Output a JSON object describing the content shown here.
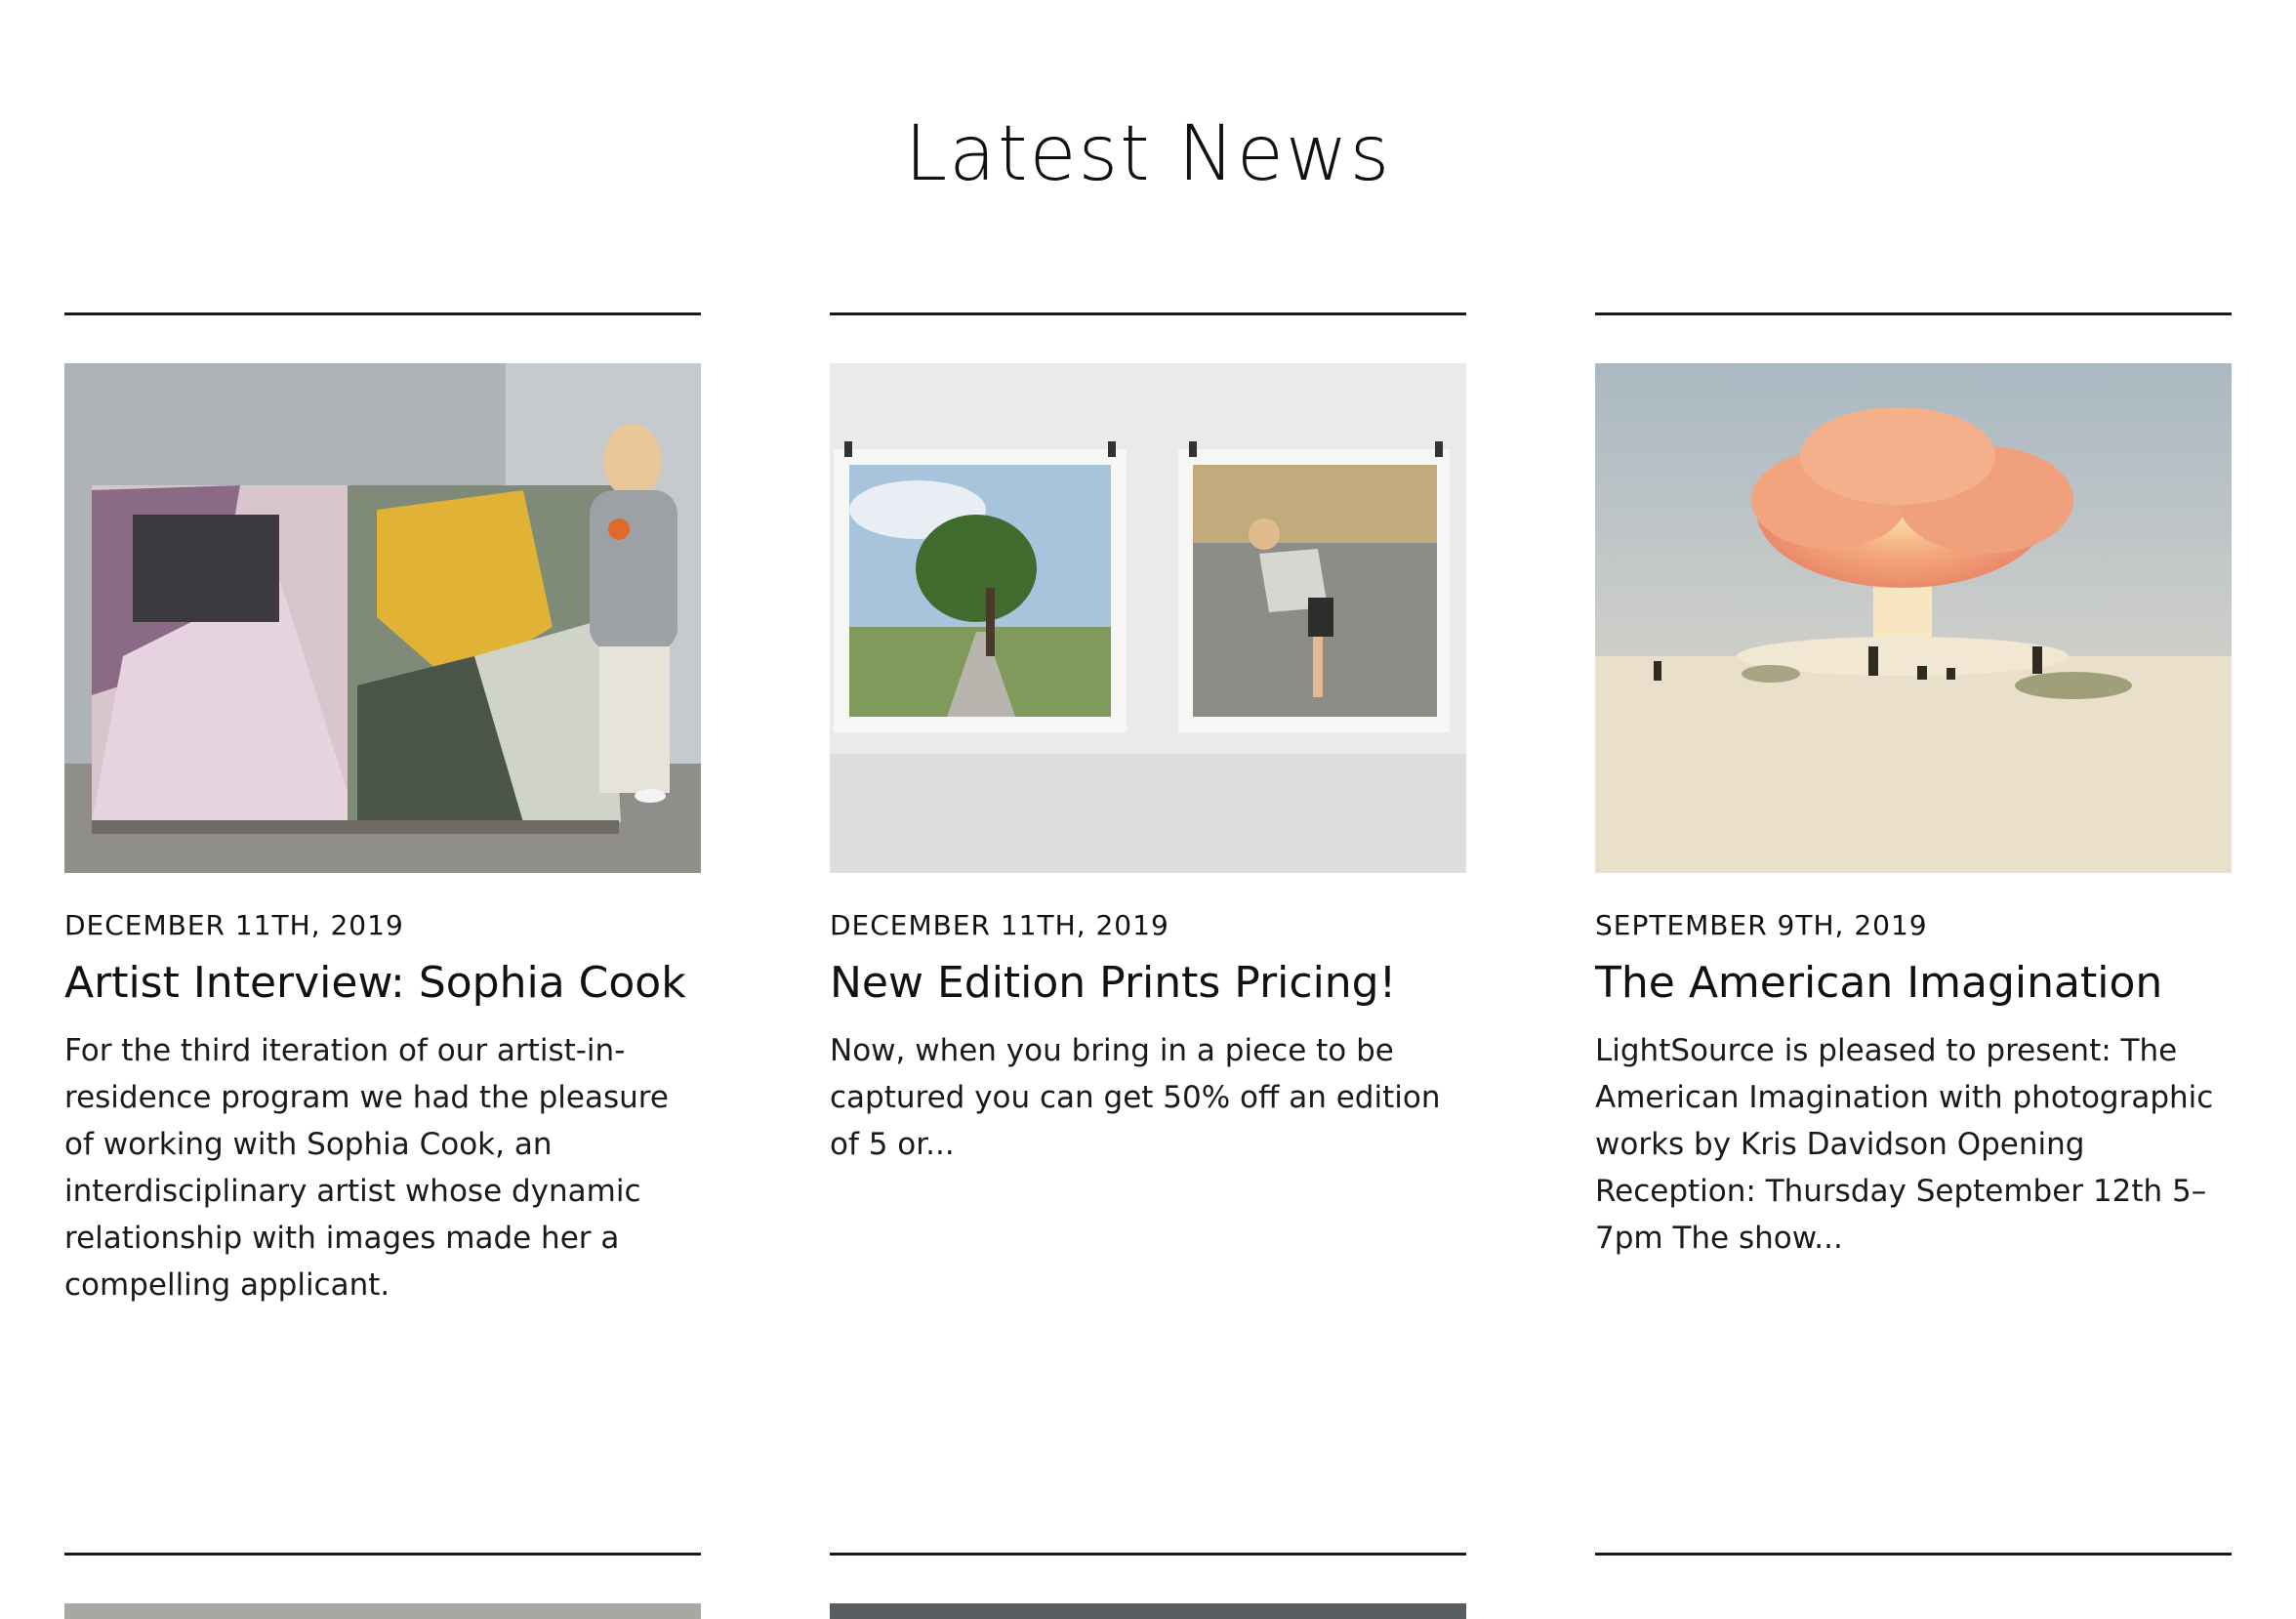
{
  "section": {
    "title": "Latest News"
  },
  "posts": [
    {
      "date": "DECEMBER 11TH, 2019",
      "title": "Artist Interview: Sophia Cook",
      "excerpt": "For the third iteration of our artist-in-residence program we had the pleasure of working with Sophia Cook, an interdisciplinary artist whose dynamic relationship with images made her a compelling applicant.",
      "image": "artist-with-large-painted-panel"
    },
    {
      "date": "DECEMBER 11TH, 2019",
      "title": "New Edition Prints Pricing!",
      "excerpt": "Now, when you bring in a piece to be captured you can get 50% off an edition of 5 or...",
      "image": "two-framed-prints-on-wall"
    },
    {
      "date": "SEPTEMBER 9TH, 2019",
      "title": "The American Imagination",
      "excerpt": "LightSource is pleased to present: The American Imagination with photographic works by Kris Davidson Opening Reception: Thursday September 12th 5–7pm The show...",
      "image": "desert-explosion-cloud"
    }
  ],
  "colors": {
    "text": "#111111",
    "rule": "#1a1a1a",
    "background": "#ffffff"
  }
}
